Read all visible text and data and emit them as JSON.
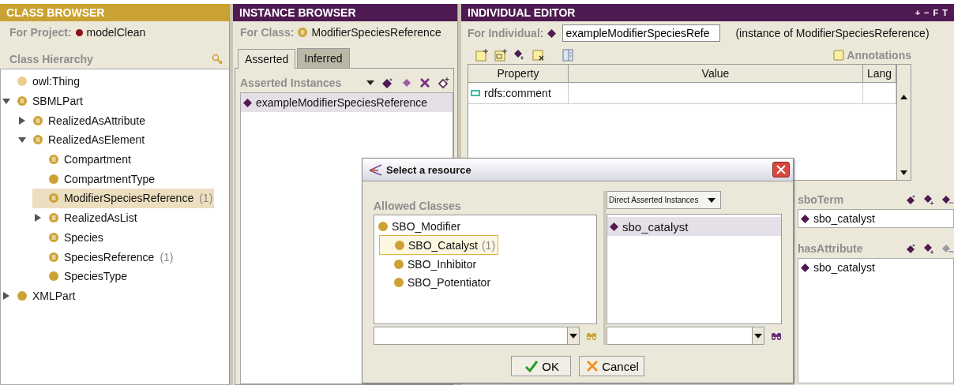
{
  "class_browser": {
    "title": "CLASS BROWSER",
    "project_label": "For Project:",
    "project": "modelClean",
    "hierarchy_label": "Class Hierarchy",
    "tree": [
      {
        "label": "owl:Thing",
        "kind": "pale",
        "selected": false
      },
      {
        "label": "SBMLPart",
        "kind": "lined",
        "expanded": true,
        "selected": false,
        "children": [
          {
            "label": "RealizedAsAttribute",
            "kind": "lined",
            "expanded": false,
            "selected": false
          },
          {
            "label": "RealizedAsElement",
            "kind": "lined",
            "expanded": true,
            "selected": false,
            "children": [
              {
                "label": "Compartment",
                "kind": "lined",
                "selected": false
              },
              {
                "label": "CompartmentType",
                "kind": "plain",
                "selected": false
              },
              {
                "label": "ModifierSpeciesReference",
                "count": "(1)",
                "kind": "lined",
                "selected": true
              },
              {
                "label": "RealizedAsList",
                "kind": "lined",
                "expanded": false,
                "selected": false
              },
              {
                "label": "Species",
                "kind": "lined",
                "selected": false
              },
              {
                "label": "SpeciesReference",
                "count": "(1)",
                "kind": "lined",
                "selected": false
              },
              {
                "label": "SpeciesType",
                "kind": "plain",
                "selected": false
              }
            ]
          }
        ]
      },
      {
        "label": "XMLPart",
        "kind": "plain",
        "expanded": false,
        "selected": false
      }
    ]
  },
  "instance_browser": {
    "title": "INSTANCE BROWSER",
    "class_label": "For Class:",
    "class_name": "ModifierSpeciesReference",
    "tabs": [
      {
        "label": "Asserted",
        "selected": true
      },
      {
        "label": "Inferred",
        "selected": false
      }
    ],
    "list_label": "Asserted Instances",
    "instances": [
      {
        "label": "exampleModifierSpeciesReference",
        "selected": true
      }
    ]
  },
  "individual_editor": {
    "title": "INDIVIDUAL EDITOR",
    "header_buttons": [
      "+",
      "−",
      "F",
      "T"
    ],
    "individual_label": "For Individual:",
    "individual": "exampleModifierSpeciesRefe",
    "instance_of": "(instance of ModifierSpeciesReference)",
    "annotations_label": "Annotations",
    "table": {
      "columns": [
        "Property",
        "Value",
        "Lang"
      ],
      "rows": [
        {
          "property": "rdfs:comment"
        }
      ]
    },
    "widgets": [
      {
        "label": "sboTerm",
        "remove_enabled": true,
        "values": [
          "sbo_catalyst"
        ]
      },
      {
        "label": "hasAttribute",
        "remove_enabled": false,
        "values": [
          "sbo_catalyst"
        ]
      }
    ]
  },
  "dialog": {
    "title": "Select a resource",
    "classes_label": "Allowed Classes",
    "classes": [
      {
        "label": "SBO_Modifier",
        "selected": false,
        "children": [
          {
            "label": "SBO_Catalyst",
            "count": "(1)",
            "selected": true
          },
          {
            "label": "SBO_Inhibitor",
            "selected": false
          },
          {
            "label": "SBO_Potentiator",
            "selected": false
          }
        ]
      }
    ],
    "view": "Direct Asserted Instances",
    "instances": [
      {
        "label": "sbo_catalyst",
        "selected": true
      }
    ],
    "buttons": [
      {
        "label": "OK",
        "kind": "ok"
      },
      {
        "label": "Cancel",
        "kind": "cancel"
      }
    ]
  }
}
